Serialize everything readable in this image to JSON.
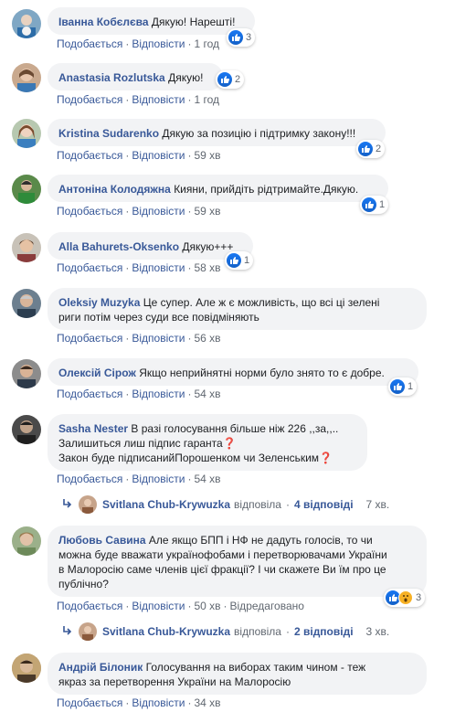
{
  "comments": [
    {
      "author": "Іванна Кобєлєва",
      "text": "Дякую! Нарешті!",
      "meta": {
        "like": "Подобається",
        "reply": "Відповісти",
        "time": "1 год"
      },
      "reactions": {
        "count": "3",
        "types": [
          "like-icon"
        ]
      }
    },
    {
      "author": "Anastasia Rozlutska",
      "text": "Дякую!",
      "meta": {
        "like": "Подобається",
        "reply": "Відповісти",
        "time": "1 год"
      },
      "reactions": {
        "count": "2",
        "types": [
          "like-icon"
        ]
      }
    },
    {
      "author": "Kristina Sudarenko",
      "text": "Дякую за позицію і підтримку закону!!!",
      "meta": {
        "like": "Подобається",
        "reply": "Відповісти",
        "time": "59 хв"
      },
      "reactions": {
        "count": "2",
        "types": [
          "like-icon"
        ]
      }
    },
    {
      "author": "Антоніна Колодяжна",
      "text": "Кияни, прийдіть рідтримайте.Дякую.",
      "meta": {
        "like": "Подобається",
        "reply": "Відповісти",
        "time": "59 хв"
      },
      "reactions": {
        "count": "1",
        "types": [
          "like-icon"
        ]
      }
    },
    {
      "author": "Alla Bahurets-Oksenko",
      "text": "Дякую+++",
      "meta": {
        "like": "Подобається",
        "reply": "Відповісти",
        "time": "58 хв"
      },
      "reactions": {
        "count": "1",
        "types": [
          "like-icon"
        ]
      }
    },
    {
      "author": "Oleksiy Muzyka",
      "text": "Це супер. Але ж є можливість, що всі ці зелені",
      "text2": "риги потім через суди все повідміняють",
      "meta": {
        "like": "Подобається",
        "reply": "Відповісти",
        "time": "56 хв"
      }
    },
    {
      "author": "Олексій Сірож",
      "text": "Якщо неприйнятні норми було знято то є добре.",
      "meta": {
        "like": "Подобається",
        "reply": "Відповісти",
        "time": "54 хв"
      },
      "reactions": {
        "count": "1",
        "types": [
          "like-icon"
        ]
      }
    },
    {
      "author": "Sasha Nester",
      "text": "В разі голосування більше ніж 226 ,,за,,..",
      "text2": "Залишиться лиш підпис гаранта❓",
      "text3": "Закон буде підписанийПорошенком чи Зеленським❓",
      "meta": {
        "like": "Подобається",
        "reply": "Відповісти",
        "time": "54 хв"
      }
    },
    {
      "author": "Любовь Савина",
      "text": "Але якщо БПП і НФ не дадуть голосів, то чи",
      "text2": "можна буде вважати українофобами і перетворювачами України",
      "text3": "в Малоросію саме членів цієї фракції? І чи скажете Ви їм про це",
      "text4": "публічно?",
      "meta": {
        "like": "Подобається",
        "reply": "Відповісти",
        "time": "50 хв",
        "edited": "Відредаговано"
      },
      "reactions": {
        "count": "3",
        "types": [
          "like-icon",
          "wow-icon"
        ]
      }
    },
    {
      "author": "Андрій Білоник",
      "text": "Голосування на виборах таким чином - теж",
      "text2": "якраз за перетворення України на Малоросію",
      "meta": {
        "like": "Подобається",
        "reply": "Відповісти",
        "time": "34 хв"
      }
    }
  ],
  "replies": [
    {
      "name": "Svitlana Chub-Krywuzka",
      "action": "відповіла",
      "count": "4 відповіді",
      "time": "7 хв."
    },
    {
      "name": "Svitlana Chub-Krywuzka",
      "action": "відповіла",
      "count": "2 відповіді",
      "time": "3 хв."
    }
  ],
  "separator": "·"
}
